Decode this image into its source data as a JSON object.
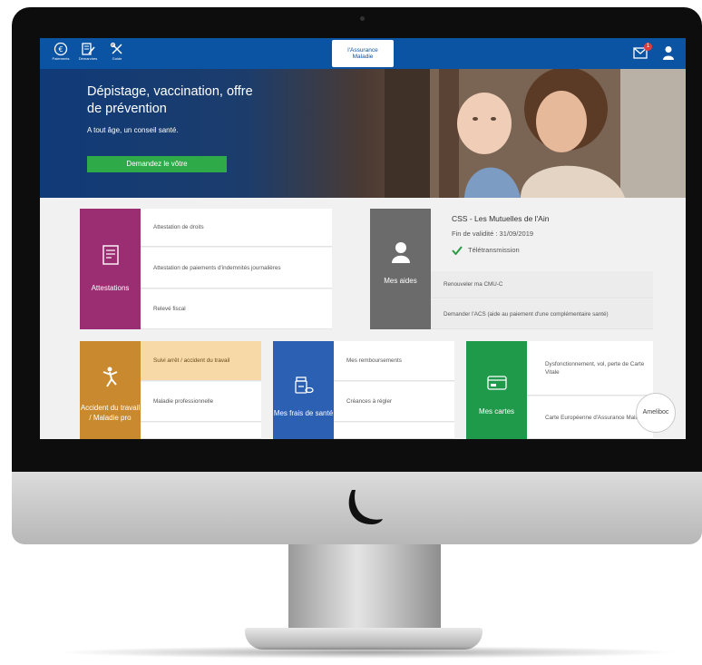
{
  "topbar": {
    "nav": [
      {
        "label": "Paiements",
        "icon": "euro-icon"
      },
      {
        "label": "Démarches",
        "icon": "form-edit-icon"
      },
      {
        "label": "Guide",
        "icon": "tools-icon"
      }
    ],
    "brand_label": "l'Assurance Maladie",
    "mail_badge": "1"
  },
  "hero": {
    "title": "Dépistage, vaccination, offre de prévention",
    "subtitle": "A tout âge, un conseil santé.",
    "button": "Demandez le vôtre"
  },
  "attestations": {
    "tile_label": "Attestations",
    "links": [
      "Attestation de droits",
      "Attestation de paiements d'indemnités journalières",
      "Relevé fiscal"
    ]
  },
  "aides": {
    "tile_label": "Mes aides",
    "title": "CSS - Les Mutuelles de l'Ain",
    "validity": "Fin de validité : 31/09/2019",
    "status": "Télétransmission",
    "links": [
      "Renouveler ma CMU-C",
      "Demander l'ACS (aide au paiement d'une complémentaire santé)"
    ]
  },
  "accident": {
    "tile_label": "Accident du travail / Maladie pro",
    "links": [
      "Suivi arrêt / accident du travail",
      "Maladie professionnelle"
    ]
  },
  "frais": {
    "tile_label": "Mes frais de santé",
    "links": [
      "Mes remboursements",
      "Créances à régler"
    ]
  },
  "cartes": {
    "tile_label": "Mes cartes",
    "links": [
      "Dysfonctionnement, vol, perte de Carte Vitale",
      "Carte Européenne d'Assurance Maladie"
    ]
  },
  "amelibot": "Ameliboc",
  "colors": {
    "topbar": "#0b53a3",
    "attestations": "#9b2d72",
    "aides": "#6b6b6b",
    "accident": "#c98a2f",
    "frais": "#2b60b3",
    "cartes": "#1f9a4a",
    "cta": "#2faa48"
  }
}
